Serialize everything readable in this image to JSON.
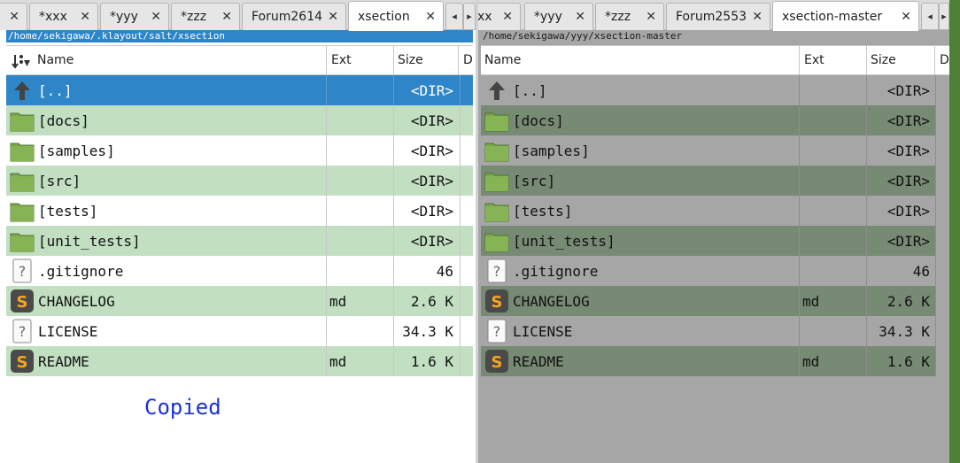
{
  "left_pane": {
    "tabs": [
      {
        "label": "",
        "active": false
      },
      {
        "label": "*xxx",
        "active": false
      },
      {
        "label": "*yyy",
        "active": false
      },
      {
        "label": "*zzz",
        "active": false
      },
      {
        "label": "Forum2614",
        "active": false
      },
      {
        "label": "xsection",
        "active": true
      }
    ],
    "path": "/home/sekigawa/.klayout/salt/xsection",
    "columns": {
      "name": "Name",
      "ext": "Ext",
      "size": "Size",
      "date": "D"
    },
    "rows": [
      {
        "icon": "parent-dir-icon",
        "name": "[..]",
        "ext": "",
        "size": "<DIR>",
        "state": "selected"
      },
      {
        "icon": "folder-icon",
        "name": "[docs]",
        "ext": "",
        "size": "<DIR>",
        "state": "alt"
      },
      {
        "icon": "folder-icon",
        "name": "[samples]",
        "ext": "",
        "size": "<DIR>",
        "state": "normal"
      },
      {
        "icon": "folder-icon",
        "name": "[src]",
        "ext": "",
        "size": "<DIR>",
        "state": "alt"
      },
      {
        "icon": "folder-icon",
        "name": "[tests]",
        "ext": "",
        "size": "<DIR>",
        "state": "normal"
      },
      {
        "icon": "folder-icon",
        "name": "[unit_tests]",
        "ext": "",
        "size": "<DIR>",
        "state": "alt"
      },
      {
        "icon": "unknown-file-icon",
        "name": ".gitignore",
        "ext": "",
        "size": "46",
        "state": "normal"
      },
      {
        "icon": "sublime-file-icon",
        "name": "CHANGELOG",
        "ext": "md",
        "size": "2.6 K",
        "state": "alt"
      },
      {
        "icon": "unknown-file-icon",
        "name": "LICENSE",
        "ext": "",
        "size": "34.3 K",
        "state": "normal"
      },
      {
        "icon": "sublime-file-icon",
        "name": "README",
        "ext": "md",
        "size": "1.6 K",
        "state": "alt"
      }
    ],
    "status_message": "Copied"
  },
  "right_pane": {
    "tabs": [
      {
        "label": "xx",
        "active": false
      },
      {
        "label": "*yyy",
        "active": false
      },
      {
        "label": "*zzz",
        "active": false
      },
      {
        "label": "Forum2553",
        "active": false
      },
      {
        "label": "xsection-master",
        "active": true
      }
    ],
    "path": "/home/sekigawa/yyy/xsection-master",
    "columns": {
      "name": "Name",
      "ext": "Ext",
      "size": "Size",
      "date": "D"
    },
    "rows": [
      {
        "icon": "parent-dir-icon",
        "name": "[..]",
        "ext": "",
        "size": "<DIR>",
        "state": "normal"
      },
      {
        "icon": "folder-icon",
        "name": "[docs]",
        "ext": "",
        "size": "<DIR>",
        "state": "alt"
      },
      {
        "icon": "folder-icon",
        "name": "[samples]",
        "ext": "",
        "size": "<DIR>",
        "state": "normal"
      },
      {
        "icon": "folder-icon",
        "name": "[src]",
        "ext": "",
        "size": "<DIR>",
        "state": "alt"
      },
      {
        "icon": "folder-icon",
        "name": "[tests]",
        "ext": "",
        "size": "<DIR>",
        "state": "normal"
      },
      {
        "icon": "folder-icon",
        "name": "[unit_tests]",
        "ext": "",
        "size": "<DIR>",
        "state": "alt"
      },
      {
        "icon": "unknown-file-icon",
        "name": ".gitignore",
        "ext": "",
        "size": "46",
        "state": "normal"
      },
      {
        "icon": "sublime-file-icon",
        "name": "CHANGELOG",
        "ext": "md",
        "size": "2.6 K",
        "state": "alt"
      },
      {
        "icon": "unknown-file-icon",
        "name": "LICENSE",
        "ext": "",
        "size": "34.3 K",
        "state": "normal"
      },
      {
        "icon": "sublime-file-icon",
        "name": "README",
        "ext": "md",
        "size": "1.6 K",
        "state": "alt"
      }
    ]
  },
  "colors": {
    "selection": "#2e86c8",
    "active_alt_row": "#c2dfc2",
    "inactive_pane": "#a6a6a6",
    "inactive_alt_row": "#778a73",
    "folder": "#7aa64a",
    "status_text": "#1a32d8"
  }
}
